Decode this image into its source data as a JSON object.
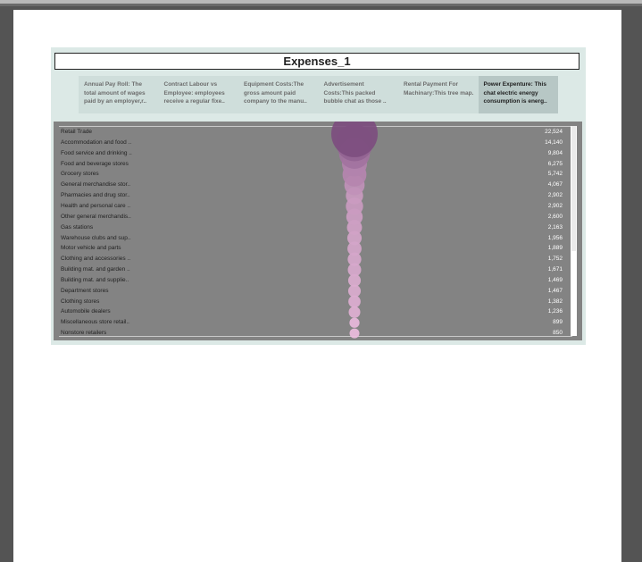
{
  "dashboard": {
    "title": "Expenses_1",
    "tabs": [
      {
        "label": "Annual Pay Roll:  The total amount of wages paid by an employer,r.."
      },
      {
        "label": "Contract Labour vs Employee: employees receive a regular fixe.."
      },
      {
        "label": "Equipment Costs:The gross amount paid company to the manu.."
      },
      {
        "label": "Advertisement Costs:This packed bubble chat as those .."
      },
      {
        "label": "Rental Payment For Machinary:This tree map."
      },
      {
        "label": "Power Expenture: This chat  electric energy consumption is energ.."
      }
    ],
    "active_tab": 5
  },
  "chart_data": {
    "type": "scatter",
    "categories": [
      "Retail Trade",
      "Accommodation and food ..",
      "Food service and drinking ..",
      "Food and beverage stores",
      "Grocery stores",
      "General merchandise stor..",
      "Pharmacies and drug stor..",
      "Health and personal care ..",
      "Other general merchandis..",
      "Gas stations",
      "Warehouse clubs and sup..",
      "Motor vehicle and parts",
      "Clothing and accessories ..",
      "Building mat. and garden ..",
      "Building mat. and supplie..",
      "Department stores",
      "Clothing stores",
      "Automobile dealers",
      "Miscellaneous store retail..",
      "Nonstore retailers"
    ],
    "values": [
      22524,
      14140,
      9804,
      6275,
      5742,
      4067,
      2902,
      2902,
      2600,
      2163,
      1956,
      1889,
      1752,
      1671,
      1469,
      1467,
      1382,
      1236,
      899,
      850
    ],
    "value_labels": [
      "22,524",
      "14,140",
      "9,804",
      "6,275",
      "5,742",
      "4,067",
      "2,902",
      "2,902",
      "2,600",
      "2,163",
      "1,956",
      "1,889",
      "1,752",
      "1,671",
      "1,469",
      "1,467",
      "1,382",
      "1,236",
      "899",
      "850"
    ],
    "colors": {
      "max": "#7d4e7f",
      "min": "#ebbcdd"
    },
    "title": "",
    "xlabel": "",
    "ylabel": ""
  }
}
